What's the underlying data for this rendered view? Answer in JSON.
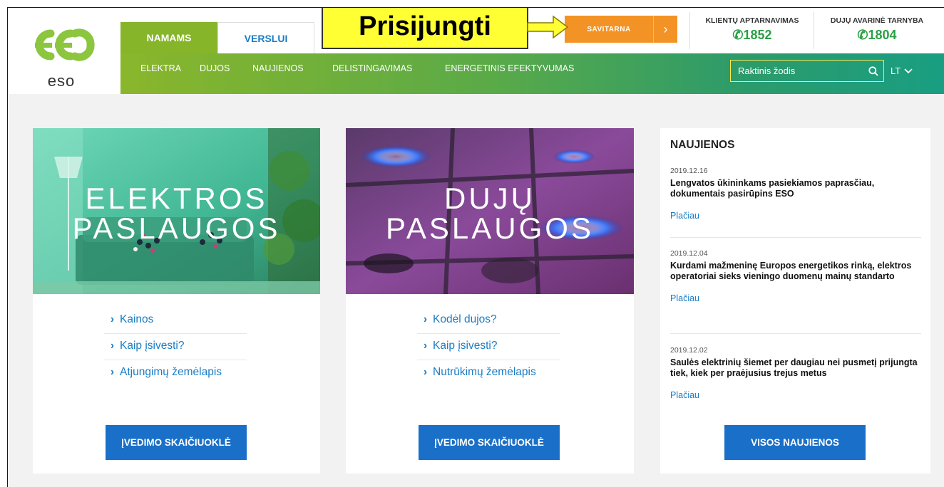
{
  "brand": {
    "name": "eso",
    "colors": {
      "green": "#86b52a",
      "blue": "#1a70c8",
      "orange": "#f39325",
      "phone_green": "#2aa043"
    }
  },
  "header": {
    "segment_tabs": [
      {
        "label": "NAMAMS",
        "active": true
      },
      {
        "label": "VERSLUI",
        "active": false
      }
    ],
    "callout": "Prisijungti",
    "self_service": {
      "label": "SAVITARNA",
      "icon": "chevron-right-icon"
    },
    "contacts": [
      {
        "label": "KLIENTŲ APTARNAVIMAS",
        "phone": "1852",
        "icon": "phone-icon"
      },
      {
        "label": "DUJŲ AVARINĖ TARNYBA",
        "phone": "1804",
        "icon": "phone-icon"
      }
    ]
  },
  "nav": {
    "items": [
      "ELEKTRA",
      "DUJOS",
      "NAUJIENOS",
      "DELISTINGAVIMAS",
      "ENERGETINIS EFEKTYVUMAS"
    ],
    "search": {
      "placeholder": "Raktinis žodis",
      "icon": "search-icon"
    },
    "language": "LT"
  },
  "cards": [
    {
      "title_line1": "ELEKTROS",
      "title_line2": "PASLAUGOS",
      "links": [
        "Kainos",
        "Kaip įsivesti?",
        "Atjungimų žemėlapis"
      ],
      "button": "ĮVEDIMO SKAIČIUOKLĖ"
    },
    {
      "title_line1": "DUJŲ",
      "title_line2": "PASLAUGOS",
      "links": [
        "Kodėl dujos?",
        "Kaip įsivesti?",
        "Nutrūkimų žemėlapis"
      ],
      "button": "ĮVEDIMO SKAIČIUOKLĖ"
    }
  ],
  "news": {
    "heading": "NAUJIENOS",
    "items": [
      {
        "date": "2019.12.16",
        "title": "Lengvatos ūkininkams pasiekiamos paprasčiau, dokumentais pasirūpins ESO",
        "more": "Plačiau"
      },
      {
        "date": "2019.12.04",
        "title": "Kurdami mažmeninę Europos energetikos rinką, elektros operatoriai sieks vieningo duomenų mainų standarto",
        "more": "Plačiau"
      },
      {
        "date": "2019.12.02",
        "title": "Saulės elektrinių šiemet per daugiau nei pusmetį prijungta tiek, kiek per praėjusius trejus metus",
        "more": "Plačiau"
      }
    ],
    "all_button": "VISOS NAUJIENOS"
  }
}
